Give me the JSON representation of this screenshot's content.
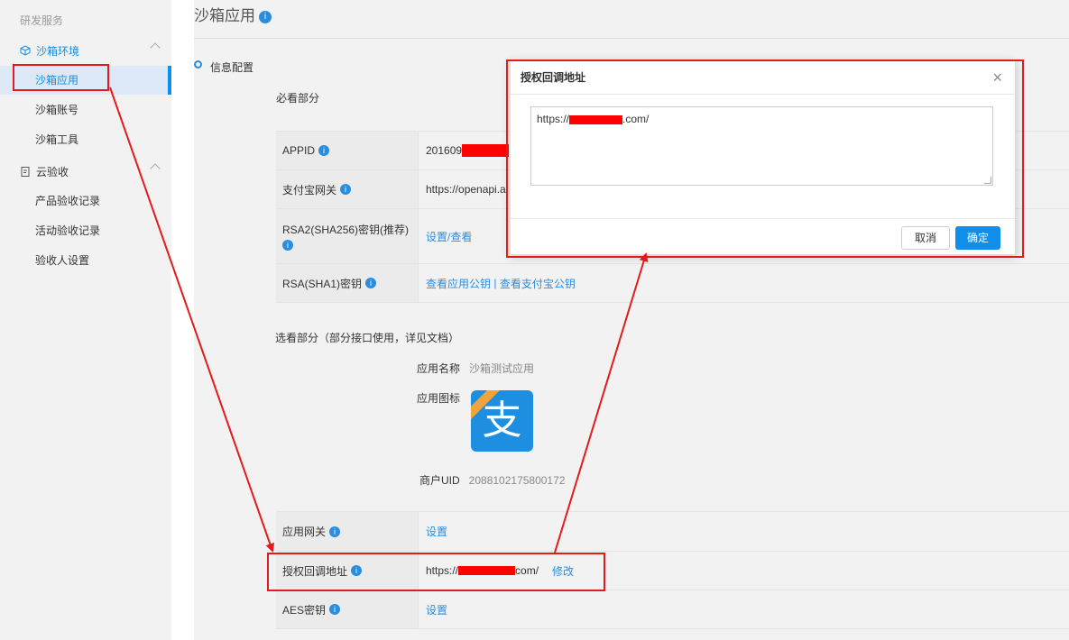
{
  "sidebar": {
    "section": "研发服务",
    "groups": [
      {
        "label": "沙箱环境",
        "items": [
          "沙箱应用",
          "沙箱账号",
          "沙箱工具"
        ]
      },
      {
        "label": "云验收",
        "items": [
          "产品验收记录",
          "活动验收记录",
          "验收人设置"
        ]
      }
    ]
  },
  "page": {
    "title": "沙箱应用",
    "step_label": "信息配置",
    "required_heading": "必看部分",
    "optional_heading": "选看部分（部分接口使用，详见文档）"
  },
  "required_rows": [
    {
      "key": "APPID",
      "value": "201609"
    },
    {
      "key": "支付宝网关",
      "value": "https://openapi.al"
    },
    {
      "key": "RSA2(SHA256)密钥(推荐)",
      "value": "设置/查看"
    },
    {
      "key": "RSA(SHA1)密钥",
      "link1": "查看应用公钥",
      "sep": " | ",
      "link2": "查看支付宝公钥"
    }
  ],
  "optional": {
    "app_name_label": "应用名称",
    "app_name_value": "沙箱测试应用",
    "app_icon_label": "应用图标",
    "app_icon_glyph": "支",
    "merchant_uid_label": "商户UID",
    "merchant_uid_value": "2088102175800172"
  },
  "bottom_rows": [
    {
      "key": "应用网关",
      "value": "设置"
    },
    {
      "key": "授权回调地址",
      "value_prefix": "https://",
      "value_suffix": "com/",
      "action": "修改"
    },
    {
      "key": "AES密钥",
      "value": "设置"
    }
  ],
  "modal": {
    "title": "授权回调地址",
    "close_glyph": "×",
    "text_prefix": "https://",
    "text_suffix": ".com/",
    "cancel_label": "取消",
    "ok_label": "确定"
  },
  "info_glyph": "i",
  "colors": {
    "accent": "#108ee9",
    "annotation": "#e21b1b",
    "redaction": "#ff0000"
  }
}
